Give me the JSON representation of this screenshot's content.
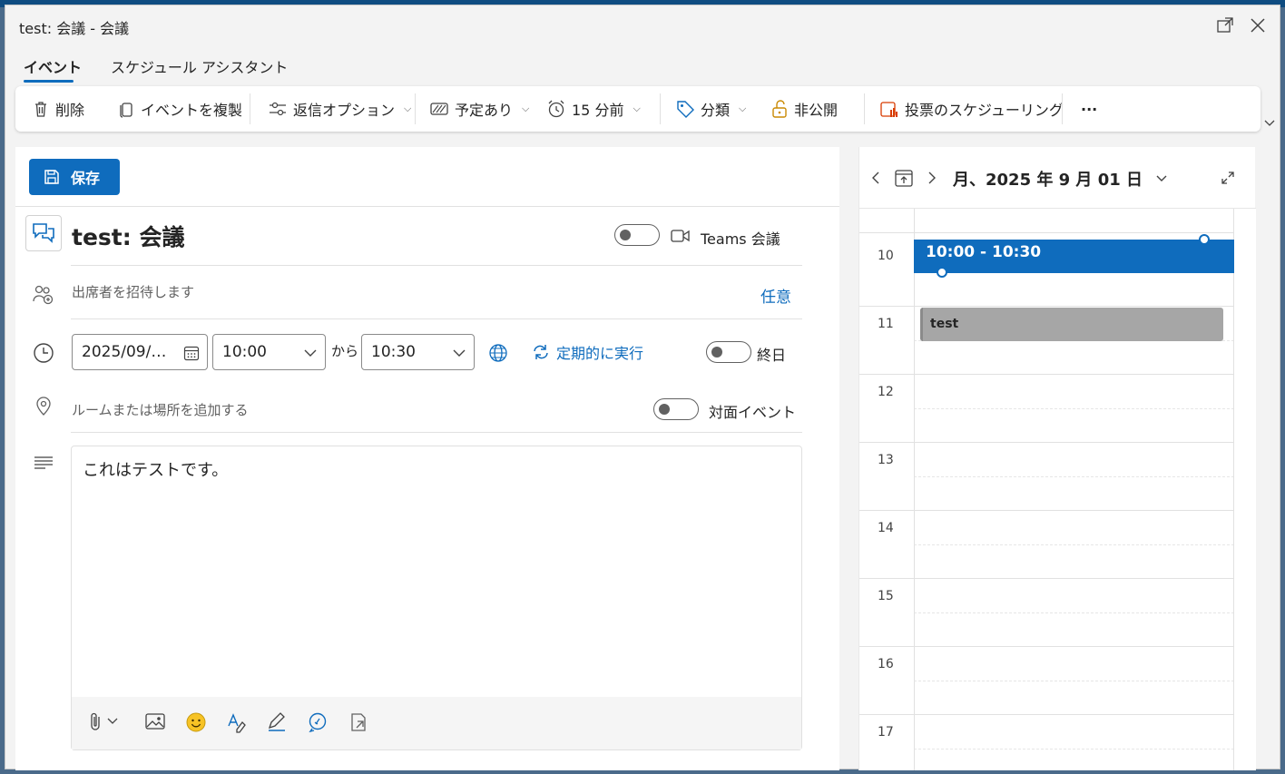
{
  "window": {
    "title": "test: 会議 - 会議",
    "popout_icon": "popout-icon",
    "close_icon": "close-icon"
  },
  "tabs": [
    {
      "label": "イベント",
      "active": true
    },
    {
      "label": "スケジュール アシスタント",
      "active": false
    }
  ],
  "ribbon": {
    "delete": "削除",
    "duplicate": "イベントを複製",
    "response_options": "返信オプション",
    "show_as": "予定あり",
    "reminder": "15 分前",
    "categorize": "分類",
    "private": "非公開",
    "poll": "投票のスケジューリング",
    "more": "···"
  },
  "form": {
    "save": "保存",
    "subject": "test: 会議",
    "teams_label": "Teams 会議",
    "attendees_placeholder": "出席者を招待します",
    "optional": "任意",
    "start_date": "2025/09/…",
    "start_time": "10:00",
    "to_label": "から",
    "end_time": "10:30",
    "recurring": "定期的に実行",
    "all_day": "終日",
    "location_placeholder": "ルームまたは場所を追加する",
    "in_person": "対面イベント",
    "body": "これはテストです。"
  },
  "calendar": {
    "title": "月、2025 年 9 月 01 日",
    "hours": [
      "10",
      "11",
      "12",
      "13",
      "14",
      "15",
      "16",
      "17"
    ],
    "events": [
      {
        "label": "10:00 - 10:30",
        "selected": true
      },
      {
        "label": "test",
        "selected": false
      }
    ]
  },
  "colors": {
    "accent": "#0f6cbd",
    "event_gray": "#a6a6a6"
  }
}
